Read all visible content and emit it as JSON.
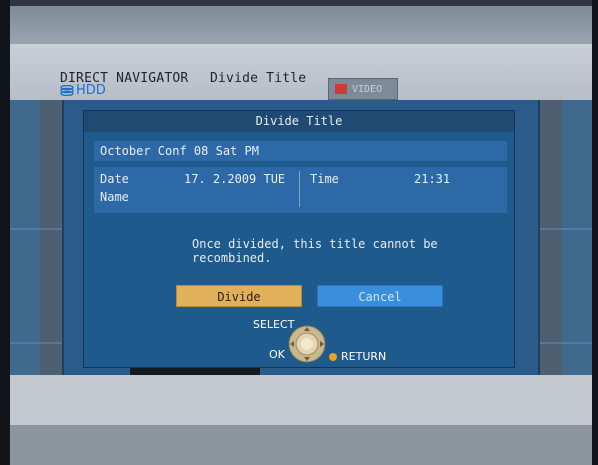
{
  "header": {
    "app": "DIRECT NAVIGATOR",
    "mode": "Divide Title",
    "drive": "HDD",
    "tab": "VIDEO"
  },
  "dialog": {
    "title": "Divide Title",
    "item_title": "October Conf 08 Sat PM",
    "date_label": "Date",
    "date_value": "17. 2.2009 TUE",
    "time_label": "Time",
    "time_value": "21:31",
    "name_label": "Name",
    "message_line1": "Once divided, this title cannot be",
    "message_line2": "recombined.",
    "divide_label": "Divide",
    "cancel_label": "Cancel"
  },
  "controls": {
    "select_label": "SELECT",
    "ok_label": "OK",
    "return_label": "RETURN"
  },
  "colors": {
    "dialog_bg": "#1f5a8c",
    "divide_button": "#e0b15a",
    "cancel_button": "#3a8fdc",
    "hdd_text": "#1d6fd0",
    "return_dot": "#f0a020"
  }
}
